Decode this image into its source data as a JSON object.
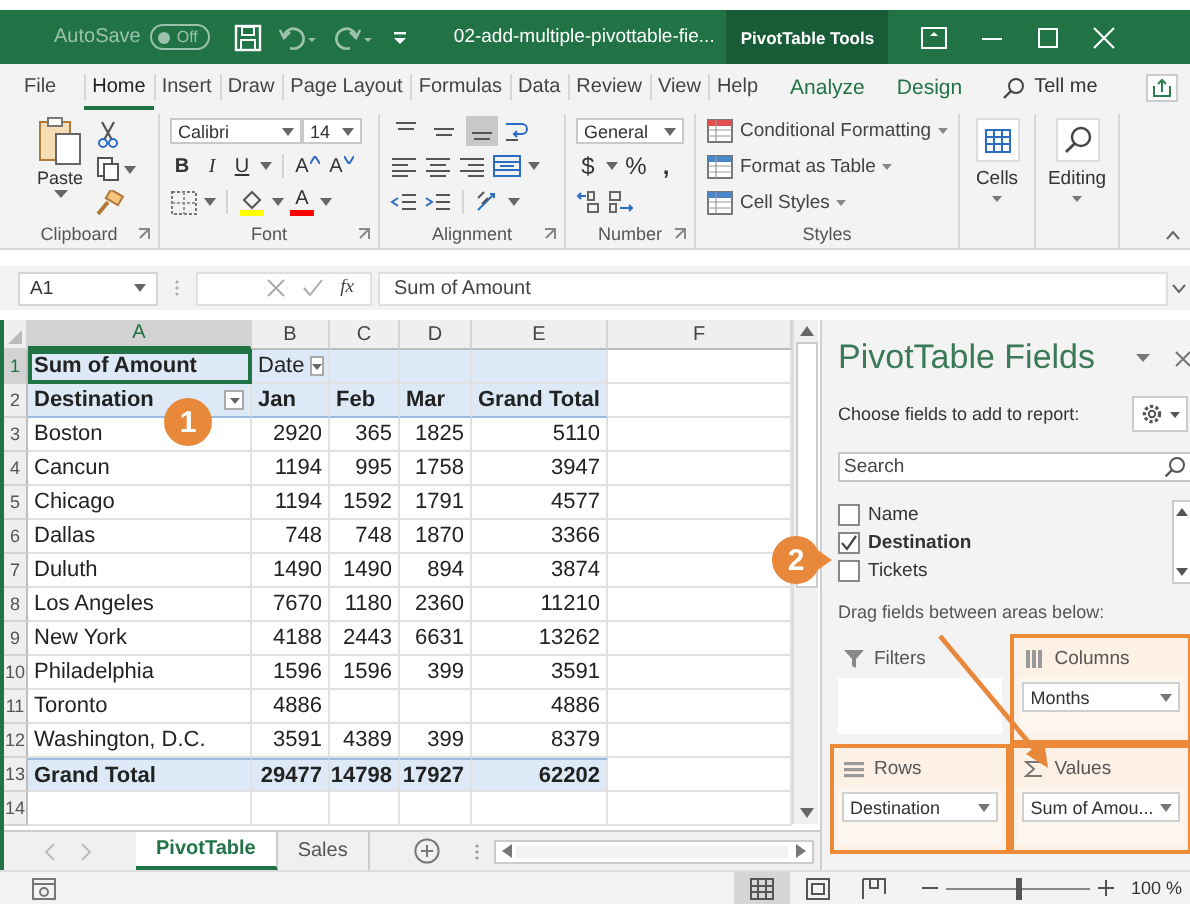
{
  "title_bar": {
    "autosave": {
      "label": "AutoSave",
      "state": "Off",
      "on": false
    },
    "file_name": "02-add-multiple-pivottable-fie...",
    "context_label": "PivotTable Tools"
  },
  "ribbon_tabs": [
    {
      "label": "File",
      "kind": "file",
      "selected": false
    },
    {
      "label": "Home",
      "kind": "normal",
      "selected": true
    },
    {
      "label": "Insert",
      "kind": "normal",
      "selected": false
    },
    {
      "label": "Draw",
      "kind": "normal",
      "selected": false
    },
    {
      "label": "Page Layout",
      "kind": "normal",
      "selected": false
    },
    {
      "label": "Formulas",
      "kind": "normal",
      "selected": false
    },
    {
      "label": "Data",
      "kind": "normal",
      "selected": false
    },
    {
      "label": "Review",
      "kind": "normal",
      "selected": false
    },
    {
      "label": "View",
      "kind": "normal",
      "selected": false
    },
    {
      "label": "Help",
      "kind": "normal",
      "selected": false
    },
    {
      "label": "Analyze",
      "kind": "context",
      "selected": false
    },
    {
      "label": "Design",
      "kind": "context",
      "selected": false
    }
  ],
  "tell_me": "Tell me",
  "ribbon": {
    "clipboard": {
      "paste": "Paste",
      "label": "Clipboard"
    },
    "font": {
      "name": "Calibri",
      "size": "14",
      "bold": "B",
      "italic": "I",
      "underline": "U",
      "grow": "A",
      "shrink": "A",
      "font_color_button": "A",
      "label": "Font"
    },
    "alignment": {
      "vertical": [
        {
          "kind": "top",
          "selected": false
        },
        {
          "kind": "middle",
          "selected": false
        },
        {
          "kind": "bottom",
          "selected": true
        }
      ],
      "label": "Alignment"
    },
    "number": {
      "format": "General",
      "currency": "$",
      "percent": "%",
      "comma": ",",
      "label": "Number"
    },
    "styles": {
      "items": [
        "Conditional Formatting",
        "Format as Table",
        "Cell Styles"
      ],
      "label": "Styles"
    },
    "cells": {
      "label": "Cells"
    },
    "editing": {
      "label": "Editing"
    }
  },
  "formula_bar": {
    "name_box": "A1",
    "fx": "fx",
    "formula": "Sum of Amount"
  },
  "grid": {
    "columns": [
      {
        "label": "A",
        "selected": true
      },
      {
        "label": "B",
        "selected": false
      },
      {
        "label": "C",
        "selected": false
      },
      {
        "label": "D",
        "selected": false
      },
      {
        "label": "E",
        "selected": false
      },
      {
        "label": "F",
        "selected": false
      }
    ],
    "rows": [
      {
        "label": "1",
        "selected": true,
        "kind": "label",
        "cells": [
          {
            "text": "Sum of Amount",
            "filter": false
          },
          {
            "text": "Date",
            "filter": true
          },
          null,
          null,
          null
        ]
      },
      {
        "label": "2",
        "selected": false,
        "kind": "header",
        "cells": [
          {
            "text": "Destination",
            "filter": true
          },
          {
            "text": "Jan",
            "filter": false
          },
          {
            "text": "Feb",
            "filter": false
          },
          {
            "text": "Mar",
            "filter": false
          },
          {
            "text": "Grand Total",
            "filter": false
          }
        ]
      },
      {
        "label": "3",
        "selected": false,
        "kind": "data",
        "cells": [
          "Boston",
          "2920",
          "365",
          "1825",
          "5110"
        ]
      },
      {
        "label": "4",
        "selected": false,
        "kind": "data",
        "cells": [
          "Cancun",
          "1194",
          "995",
          "1758",
          "3947"
        ]
      },
      {
        "label": "5",
        "selected": false,
        "kind": "data",
        "cells": [
          "Chicago",
          "1194",
          "1592",
          "1791",
          "4577"
        ]
      },
      {
        "label": "6",
        "selected": false,
        "kind": "data",
        "cells": [
          "Dallas",
          "748",
          "748",
          "1870",
          "3366"
        ]
      },
      {
        "label": "7",
        "selected": false,
        "kind": "data",
        "cells": [
          "Duluth",
          "1490",
          "1490",
          "894",
          "3874"
        ]
      },
      {
        "label": "8",
        "selected": false,
        "kind": "data",
        "cells": [
          "Los Angeles",
          "7670",
          "1180",
          "2360",
          "11210"
        ]
      },
      {
        "label": "9",
        "selected": false,
        "kind": "data",
        "cells": [
          "New York",
          "4188",
          "2443",
          "6631",
          "13262"
        ]
      },
      {
        "label": "10",
        "selected": false,
        "kind": "data",
        "cells": [
          "Philadelphia",
          "1596",
          "1596",
          "399",
          "3591"
        ]
      },
      {
        "label": "11",
        "selected": false,
        "kind": "data",
        "cells": [
          "Toronto",
          "4886",
          null,
          null,
          "4886"
        ]
      },
      {
        "label": "12",
        "selected": false,
        "kind": "data",
        "cells": [
          "Washington, D.C.",
          "3591",
          "4389",
          "399",
          "8379"
        ]
      },
      {
        "label": "13",
        "selected": false,
        "kind": "total",
        "cells": [
          "Grand Total",
          "29477",
          "14798",
          "17927",
          "62202"
        ]
      },
      {
        "label": "14",
        "selected": false,
        "kind": "empty",
        "cells": []
      }
    ]
  },
  "sheet_tabs": [
    {
      "label": "PivotTable",
      "selected": true
    },
    {
      "label": "Sales",
      "selected": false
    }
  ],
  "pivot_panel": {
    "title": "PivotTable Fields",
    "subtitle": "Choose fields to add to report:",
    "search": {
      "placeholder": "Search"
    },
    "fields": [
      {
        "label": "Name",
        "checked": false
      },
      {
        "label": "Destination",
        "checked": true
      },
      {
        "label": "Tickets",
        "checked": false
      }
    ],
    "areas_hint": "Drag fields between areas below:",
    "areas": [
      {
        "kind": "filters",
        "label": "Filters",
        "highlighted": false
      },
      {
        "kind": "columns",
        "label": "Columns",
        "highlighted": true,
        "items": [
          "Months"
        ]
      },
      {
        "kind": "rows",
        "label": "Rows",
        "highlighted": true,
        "items": [
          "Destination"
        ]
      },
      {
        "kind": "values",
        "label": "Values",
        "highlighted": true,
        "items": [
          "Sum of Amou..."
        ]
      }
    ]
  },
  "status_bar": {
    "views": [
      {
        "kind": "normal",
        "selected": true
      },
      {
        "kind": "page_layout",
        "selected": false
      },
      {
        "kind": "page_break",
        "selected": false
      }
    ],
    "zoom": {
      "level": 0.5,
      "reading": "100 %"
    }
  },
  "callouts": [
    {
      "label": "1",
      "pointer": false
    },
    {
      "label": "2",
      "pointer": true
    }
  ]
}
